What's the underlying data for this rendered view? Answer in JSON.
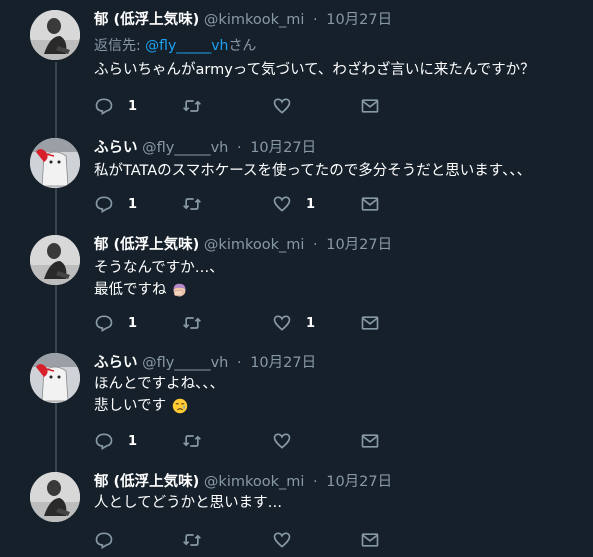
{
  "tweets": [
    {
      "name": "郁 (低浮上気味)",
      "handle": "@kimkook_mi",
      "sep": "·",
      "date": "10月27日",
      "reply_prefix": "返信先: ",
      "reply_mention": "@fly_____vh",
      "reply_suffix": "さん",
      "lines": [
        "ふらいちゃんがarmyって気づいて、わざわざ言いに来たんですか？"
      ],
      "reply_count": "1",
      "like_count": ""
    },
    {
      "name": "ふらい",
      "handle": "@fly_____vh",
      "sep": "·",
      "date": "10月27日",
      "lines": [
        "私がTATAのスマホケースを使ってたので多分そうだと思います、、、"
      ],
      "reply_count": "1",
      "like_count": "1"
    },
    {
      "name": "郁 (低浮上気味)",
      "handle": "@kimkook_mi",
      "sep": "·",
      "date": "10月27日",
      "lines": [
        "そうなんですか…、",
        "最低ですね"
      ],
      "emoji": "woman-facepalming",
      "reply_count": "1",
      "like_count": "1"
    },
    {
      "name": "ふらい",
      "handle": "@fly_____vh",
      "sep": "·",
      "date": "10月27日",
      "lines": [
        "ほんとですよね、、、",
        "悲しいです"
      ],
      "emoji": "crying-face",
      "reply_count": "1",
      "like_count": ""
    },
    {
      "name": "郁 (低浮上気味)",
      "handle": "@kimkook_mi",
      "sep": "·",
      "date": "10月27日",
      "lines": [
        "人としてどうかと思います…"
      ],
      "reply_count": "",
      "like_count": ""
    }
  ],
  "colors": {
    "background": "#15202b",
    "muted": "#8899a6",
    "link": "#1da1f2",
    "thread_line": "#38444d"
  }
}
